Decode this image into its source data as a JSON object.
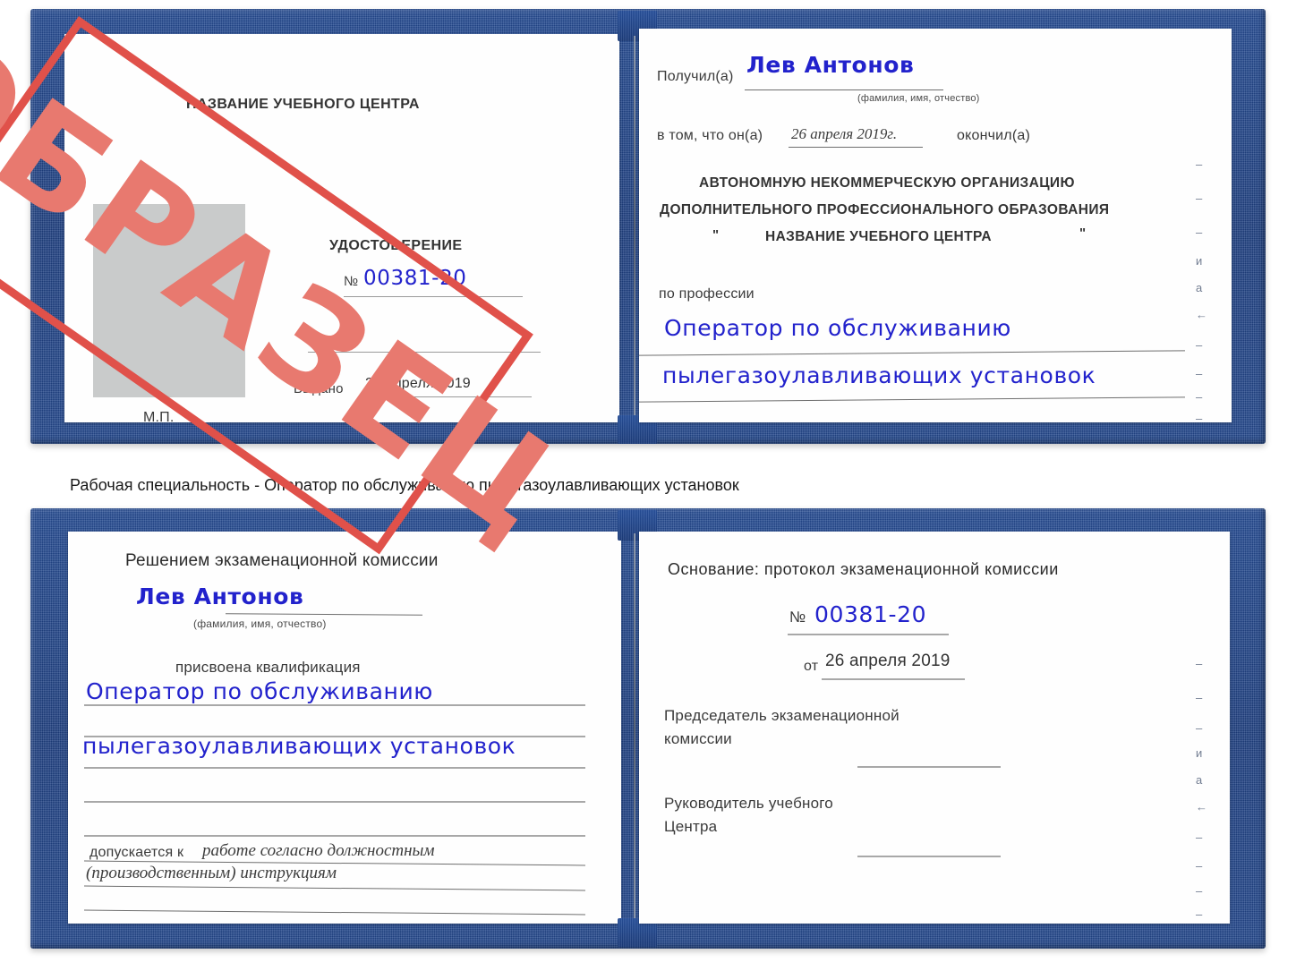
{
  "caption": "Рабочая специальность - Оператор по обслуживанию пылегазоулавливающих установок",
  "stamp": {
    "text": "ОБРАЗЕЦ",
    "border_color": "#e0514a",
    "text_color": "#e8796f"
  },
  "colors": {
    "cover": "#1e3f80",
    "handwriting": "#2222cc",
    "paper": "#fefefe",
    "photo_box": "#c9cbcb"
  },
  "certificate_top": {
    "left_page": {
      "org_title": "НАЗВАНИЕ УЧЕБНОГО ЦЕНТРА",
      "doc_type": "УДОСТОВЕРЕНИЕ",
      "number_label": "№",
      "number_value": "00381-20",
      "issued_label": "Выдано",
      "issued_value": "26 апреля 2019",
      "seal_label": "М.П."
    },
    "right_page": {
      "received_label": "Получил(а)",
      "received_value": "Лев Антонов",
      "fio_hint": "(фамилия, имя, отчество)",
      "in_that_label": "в том, что он(а)",
      "in_that_date": "26 апреля 2019г.",
      "finished_label": "окончил(а)",
      "org_line_1": "АВТОНОМНУЮ НЕКОММЕРЧЕСКУЮ ОРГАНИЗАЦИЮ",
      "org_line_2": "ДОПОЛНИТЕЛЬНОГО ПРОФЕССИОНАЛЬНОГО ОБРАЗОВАНИЯ",
      "org_quote_open": "\"",
      "org_line_3": "НАЗВАНИЕ УЧЕБНОГО ЦЕНТРА",
      "org_quote_close": "\"",
      "profession_label": "по профессии",
      "profession_value_1": "Оператор по обслуживанию",
      "profession_value_2": "пылегазоулавливающих установок",
      "margin_ghosts": [
        "–",
        "–",
        "–",
        "и",
        "а",
        "←",
        "–",
        "–",
        "–",
        "–",
        "–"
      ]
    }
  },
  "certificate_bottom": {
    "left_page": {
      "heading": "Решением экзаменационной комиссии",
      "name_value": "Лев Антонов",
      "fio_hint": "(фамилия, имя, отчество)",
      "qualification_label": "присвоена квалификация",
      "qualification_value_1": "Оператор по обслуживанию",
      "qualification_value_2": "пылегазоулавливающих установок",
      "allowed_label": "допускается к",
      "allowed_value_1": "работе согласно должностным",
      "allowed_value_2": "(производственным) инструкциям"
    },
    "right_page": {
      "basis_label": "Основание: протокол экзаменационной комиссии",
      "number_label": "№",
      "number_value": "00381-20",
      "date_label": "от",
      "date_value": "26 апреля 2019",
      "chairman_line_1": "Председатель экзаменационной",
      "chairman_line_2": "комиссии",
      "head_line_1": "Руководитель учебного",
      "head_line_2": "Центра",
      "margin_ghosts": [
        "–",
        "–",
        "–",
        "и",
        "а",
        "←",
        "–",
        "–",
        "–",
        "–"
      ]
    }
  }
}
